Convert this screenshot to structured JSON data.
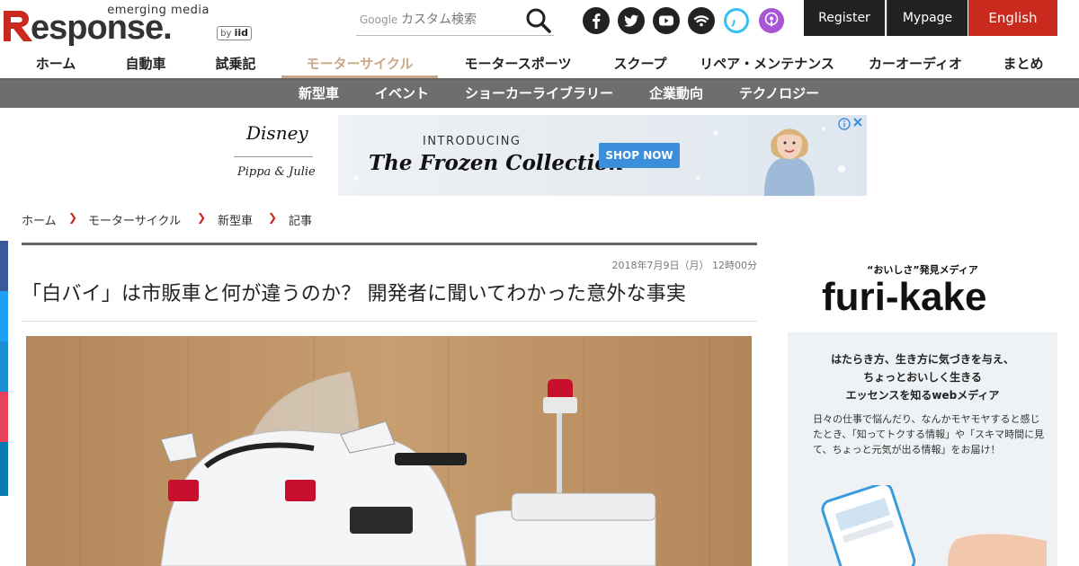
{
  "header": {
    "logo_tag": "emerging media",
    "logo_word": "esponse.",
    "logo_by": "by",
    "logo_iid": "iid",
    "search_brand": "Google",
    "search_placeholder": "カスタム検索",
    "register_label": "Register",
    "mypage_label": "Mypage",
    "english_label": "English",
    "social": [
      {
        "name": "facebook-icon",
        "color": "#222222"
      },
      {
        "name": "twitter-icon",
        "color": "#222222"
      },
      {
        "name": "youtube-icon",
        "color": "#222222"
      },
      {
        "name": "rss-icon",
        "color": "#222222"
      },
      {
        "name": "alexa-icon",
        "color": "#36c0f0"
      },
      {
        "name": "podcast-icon",
        "color": "#a855d6"
      }
    ]
  },
  "nav": {
    "items": [
      {
        "label": "ホーム"
      },
      {
        "label": "自動車"
      },
      {
        "label": "試乗記"
      },
      {
        "label": "モーターサイクル",
        "active": true
      },
      {
        "label": "モータースポーツ"
      },
      {
        "label": "スクープ"
      },
      {
        "label": "リペア・メンテナンス"
      },
      {
        "label": "カーオーディオ"
      },
      {
        "label": "まとめ"
      }
    ],
    "sub_items": [
      {
        "label": "新型車"
      },
      {
        "label": "イベント"
      },
      {
        "label": "ショーカーライブラリー"
      },
      {
        "label": "企業動向"
      },
      {
        "label": "テクノロジー"
      }
    ]
  },
  "ad": {
    "brand": "Disney",
    "brand_sub": "Pippa & Julie",
    "intro": "INTRODUCING",
    "title": "The Frozen Collection",
    "cta": "SHOP NOW"
  },
  "breadcrumb": {
    "items": [
      "ホーム",
      "モーターサイクル",
      "新型車",
      "記事"
    ]
  },
  "article": {
    "date": "2018年7月9日（月） 12時00分",
    "title": "「白バイ」は市販車と何が違うのか？ 開発者に聞いてわかった意外な事実"
  },
  "sidebar_ad": {
    "kicker": "“おいしさ”発見メディア",
    "logo": "furi-kake",
    "line1": "はたらき方、生き方に気づきを与え、",
    "line2": "ちょっとおいしく生きる",
    "line3": "エッセンスを知るwebメディア",
    "body": "日々の仕事で悩んだり、なんかモヤモヤすると感じたとき、「知ってトクする情報」や「スキマ時間に見て、ちょっと元気が出る情報」をお届け！"
  },
  "colors": {
    "accent": "#c92a1d",
    "nav_active": "#c9a888",
    "subnav_bg": "#6e6e6e",
    "header_btn": "#222222"
  }
}
